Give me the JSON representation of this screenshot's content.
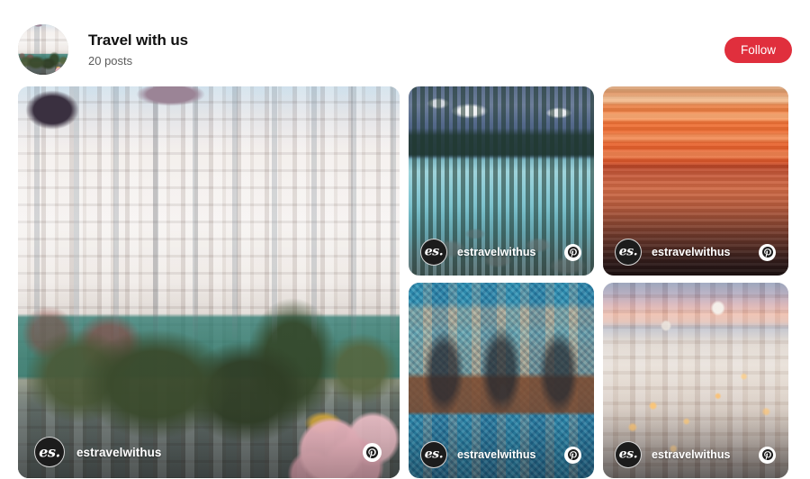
{
  "profile": {
    "name": "Travel with us",
    "posts_label": "20 posts",
    "avatar_icon": "profile-avatar-image",
    "follow_label": "Follow",
    "follow_color": "#e02f3d"
  },
  "watermark": {
    "logo_text": "es.",
    "username": "estravelwithus",
    "pin_icon": "pinterest-icon"
  },
  "grid": {
    "cards": [
      {
        "id": "card-istanbul",
        "art": "art-istanbul",
        "alt": "Ornate white Ottoman waterfront mansions with green garden and pink blossoms",
        "username": "estravelwithus",
        "logo_text": "es.",
        "pin_icon": "pinterest-icon"
      },
      {
        "id": "card-lake",
        "art": "art-lake",
        "alt": "Turquoise alpine lake with snowy mountains and pine forest",
        "username": "estravelwithus",
        "logo_text": "es.",
        "pin_icon": "pinterest-icon"
      },
      {
        "id": "card-sunset",
        "art": "art-sunset",
        "alt": "Orange sunset over calm ocean",
        "username": "estravelwithus",
        "logo_text": "es.",
        "pin_icon": "pinterest-icon"
      },
      {
        "id": "card-mosque",
        "art": "art-mosque",
        "alt": "Blue tiled Islamic madrasa facade with arched iwans",
        "username": "estravelwithus",
        "logo_text": "es.",
        "pin_icon": "pinterest-icon"
      },
      {
        "id": "card-santorini",
        "art": "art-santorini",
        "alt": "Santorini Oia white village with windmills at dusk",
        "username": "estravelwithus",
        "logo_text": "es.",
        "pin_icon": "pinterest-icon"
      }
    ]
  }
}
